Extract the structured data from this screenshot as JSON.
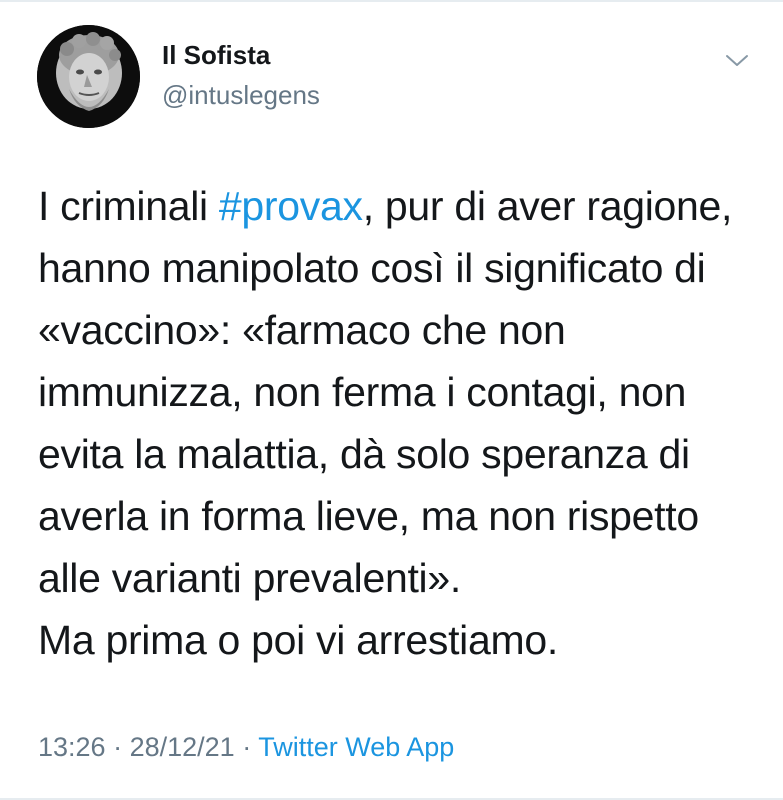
{
  "user": {
    "display_name": "Il Sofista",
    "handle": "@intuslegens",
    "avatar_icon": "bust-portrait-avatar"
  },
  "menu": {
    "icon": "chevron-down-icon"
  },
  "tweet": {
    "lines": [
      {
        "before": "I criminali ",
        "hashtag": "#provax",
        "after": ", pur di aver ragione,"
      },
      {
        "text": "hanno manipolato così il significato di"
      },
      {
        "text": "«vaccino»: «farmaco che non"
      },
      {
        "text": "immunizza, non ferma i contagi, non"
      },
      {
        "text": "evita la malattia, dà solo speranza di"
      },
      {
        "text": "averla in forma lieve, ma non rispetto"
      },
      {
        "text": "alle varianti prevalenti»."
      },
      {
        "text": "Ma prima o poi vi arrestiamo."
      }
    ]
  },
  "meta": {
    "time": "13:26",
    "separator": " · ",
    "date": "28/12/21",
    "source": "Twitter Web App"
  },
  "colors": {
    "link": "#1b95e0",
    "text": "#14171a",
    "secondary": "#657786"
  }
}
